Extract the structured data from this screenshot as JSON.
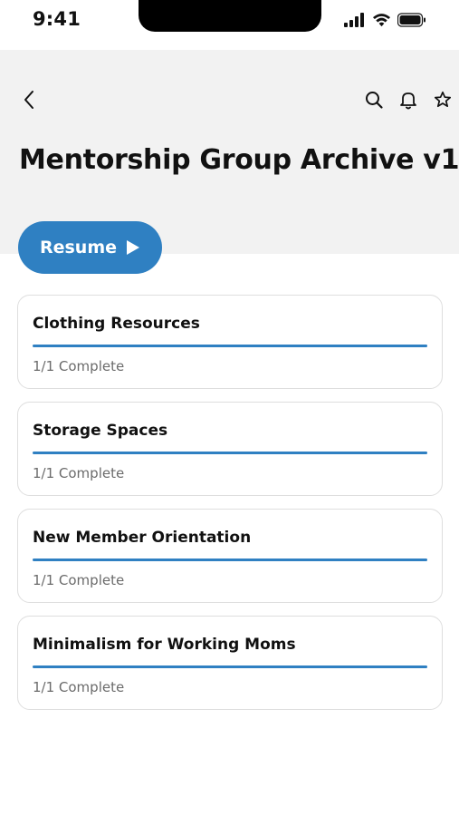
{
  "status_bar": {
    "time": "9:41"
  },
  "header": {
    "title": "Mentorship Group Archive v1",
    "icons": {
      "back": "chevron-left-icon",
      "search": "search-icon",
      "notifications": "bell-icon",
      "favorite": "star-icon"
    }
  },
  "resume": {
    "label": "Resume",
    "icon": "play-icon"
  },
  "colors": {
    "accent": "#2f80c2",
    "header_bg": "#f2f2f2",
    "card_border": "#dedede",
    "muted_text": "#6b6b6b"
  },
  "modules": [
    {
      "title": "Clothing Resources",
      "status": "1/1 Complete",
      "progress": 1.0
    },
    {
      "title": "Storage Spaces",
      "status": "1/1 Complete",
      "progress": 1.0
    },
    {
      "title": "New Member Orientation",
      "status": "1/1 Complete",
      "progress": 1.0
    },
    {
      "title": "Minimalism for Working Moms",
      "status": "1/1 Complete",
      "progress": 1.0
    }
  ]
}
